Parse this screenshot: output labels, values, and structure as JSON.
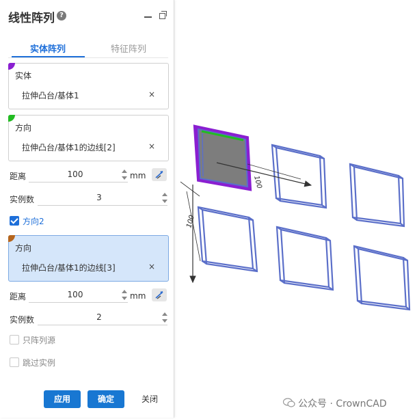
{
  "panel": {
    "title": "线性阵列",
    "help_glyph": "?",
    "tabs": [
      {
        "label": "实体阵列",
        "active": true
      },
      {
        "label": "特征阵列",
        "active": false
      }
    ],
    "entity_box": {
      "label": "实体",
      "value": "拉伸凸台/基体1",
      "clear": "×",
      "marker_color": "#8a1fd1"
    },
    "direction1_box": {
      "label": "方向",
      "value": "拉伸凸台/基体1的边线[2]",
      "clear": "×",
      "marker_color": "#22bb22"
    },
    "direction1": {
      "distance_label": "距离",
      "distance_value": "100",
      "unit": "mm",
      "count_label": "实例数",
      "count_value": "3"
    },
    "direction2_checkbox": {
      "label": "方向2",
      "checked": true
    },
    "direction2_box": {
      "label": "方向",
      "value": "拉伸凸台/基体1的边线[3]",
      "clear": "×",
      "marker_color": "#b5651d"
    },
    "direction2": {
      "distance_label": "距离",
      "distance_value": "100",
      "unit": "mm",
      "count_label": "实例数",
      "count_value": "2"
    },
    "only_pattern_source": {
      "label": "只阵列源",
      "checked": false
    },
    "skip_instances": {
      "label": "跳过实例",
      "checked": false
    },
    "buttons": {
      "apply": "应用",
      "ok": "确定",
      "close": "关闭"
    }
  },
  "viewport": {
    "dimension_dir1": "100",
    "dimension_dir2": "100",
    "wireframe_color": "#5b6fc9",
    "source_outline_color": "#8a1fd1",
    "source_edge_color": "#22bb22"
  },
  "watermark": "公众号 · CrownCAD",
  "colors": {
    "accent": "#1e6fd9",
    "primary_button": "#1877d2",
    "selected_box": "#d5e6fa"
  }
}
